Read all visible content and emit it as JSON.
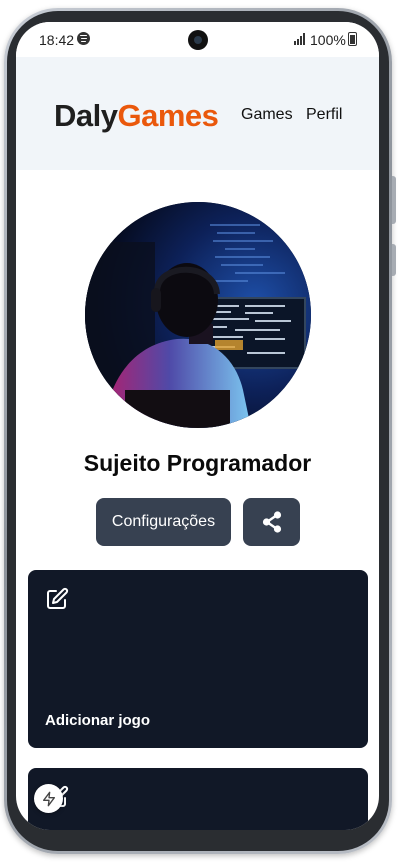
{
  "status_bar": {
    "time": "18:42",
    "battery": "100%"
  },
  "header": {
    "logo_part1": "Daly",
    "logo_part2": "Games",
    "nav": [
      "Games",
      "Perfil"
    ]
  },
  "profile": {
    "name": "Sujeito Programador",
    "settings_label": "Configurações"
  },
  "cards": [
    {
      "label": "Adicionar jogo",
      "icon": "edit-icon"
    },
    {
      "label": "",
      "icon": "edit-icon"
    }
  ],
  "icons": {
    "share": "share-icon",
    "fab": "bolt-icon",
    "status_app": "spotify-icon"
  },
  "colors": {
    "accent": "#ea580c",
    "header_bg": "#f1f5f9",
    "button_bg": "#374151",
    "card_bg": "#111827"
  }
}
